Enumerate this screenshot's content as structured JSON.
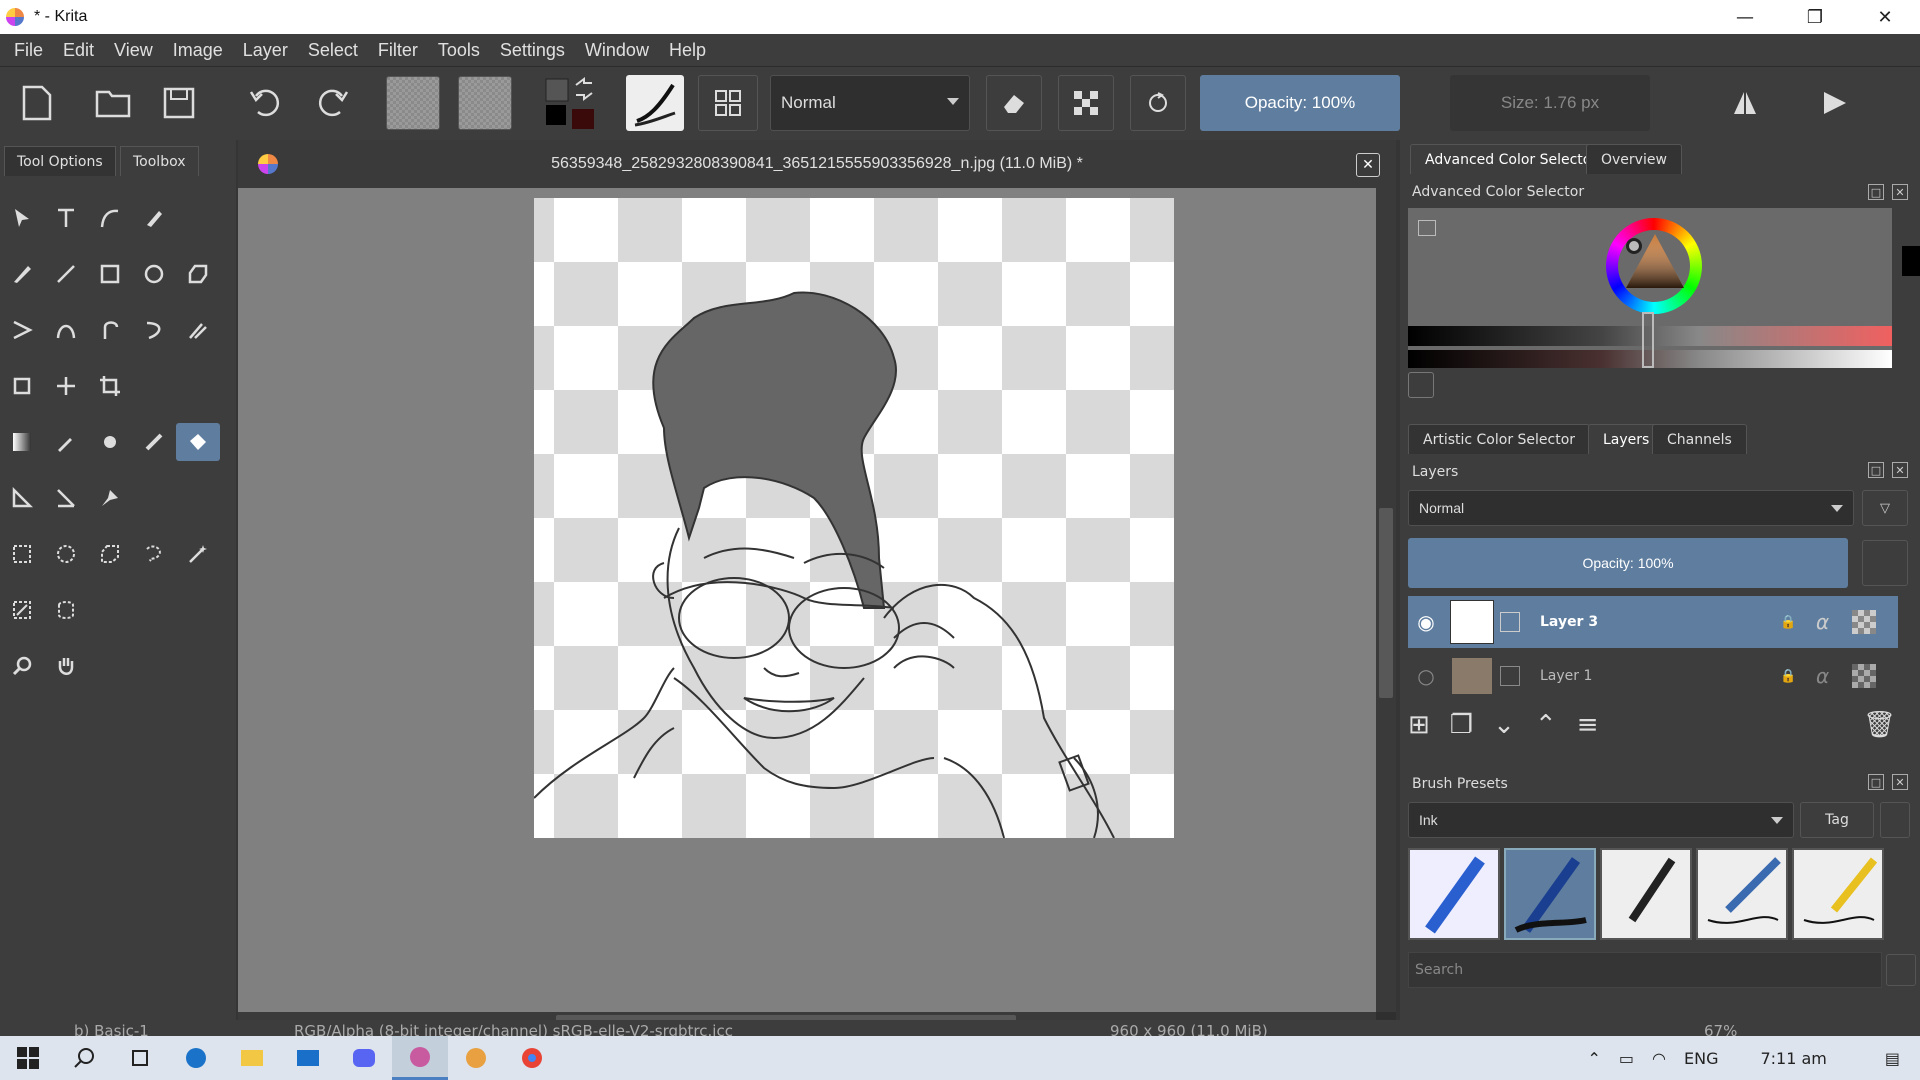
{
  "window": {
    "title": "* - Krita",
    "minimize": "—",
    "restore": "❐",
    "close": "✕"
  },
  "menu": [
    "File",
    "Edit",
    "View",
    "Image",
    "Layer",
    "Select",
    "Filter",
    "Tools",
    "Settings",
    "Window",
    "Help"
  ],
  "toolbar": {
    "blend_mode": "Normal",
    "opacity_label": "Opacity: 100%",
    "opacity_value": 1.0,
    "size_label": "Size: 1.76 px"
  },
  "left_dock": {
    "tabs": [
      "Tool Options",
      "Toolbox"
    ],
    "active_tab": "Toolbox"
  },
  "document": {
    "title": "56359348_2582932808390841_3651215555903356928_n.jpg (11.0 MiB) *"
  },
  "right_dock": {
    "color_tabs": [
      "Advanced Color Selector",
      "Overview"
    ],
    "color_panel_title": "Advanced Color Selector",
    "layer_tabs": [
      "Artistic Color Selector",
      "Layers",
      "Channels"
    ],
    "layers_title": "Layers",
    "layer_blend_mode": "Normal",
    "layer_opacity": "Opacity:  100%",
    "layers": [
      {
        "name": "Layer 3",
        "visible": true,
        "selected": true
      },
      {
        "name": "Layer 1",
        "visible": false,
        "selected": false
      }
    ],
    "brush_title": "Brush Presets",
    "brush_tag": "Ink",
    "tag_button": "Tag",
    "search_placeholder": "Search"
  },
  "statusbar": {
    "brush": "b) Basic-1",
    "color_space": "RGB/Alpha (8-bit integer/channel)  sRGB-elle-V2-srgbtrc.icc",
    "image_size": "960 x 960 (11.0 MiB)",
    "zoom": "67%"
  },
  "taskbar": {
    "language": "ENG",
    "time": "7:11 am"
  },
  "colors": {
    "accent": "#5f7e9f",
    "panel": "#3d3d3d",
    "canvas_bg": "#808080"
  }
}
